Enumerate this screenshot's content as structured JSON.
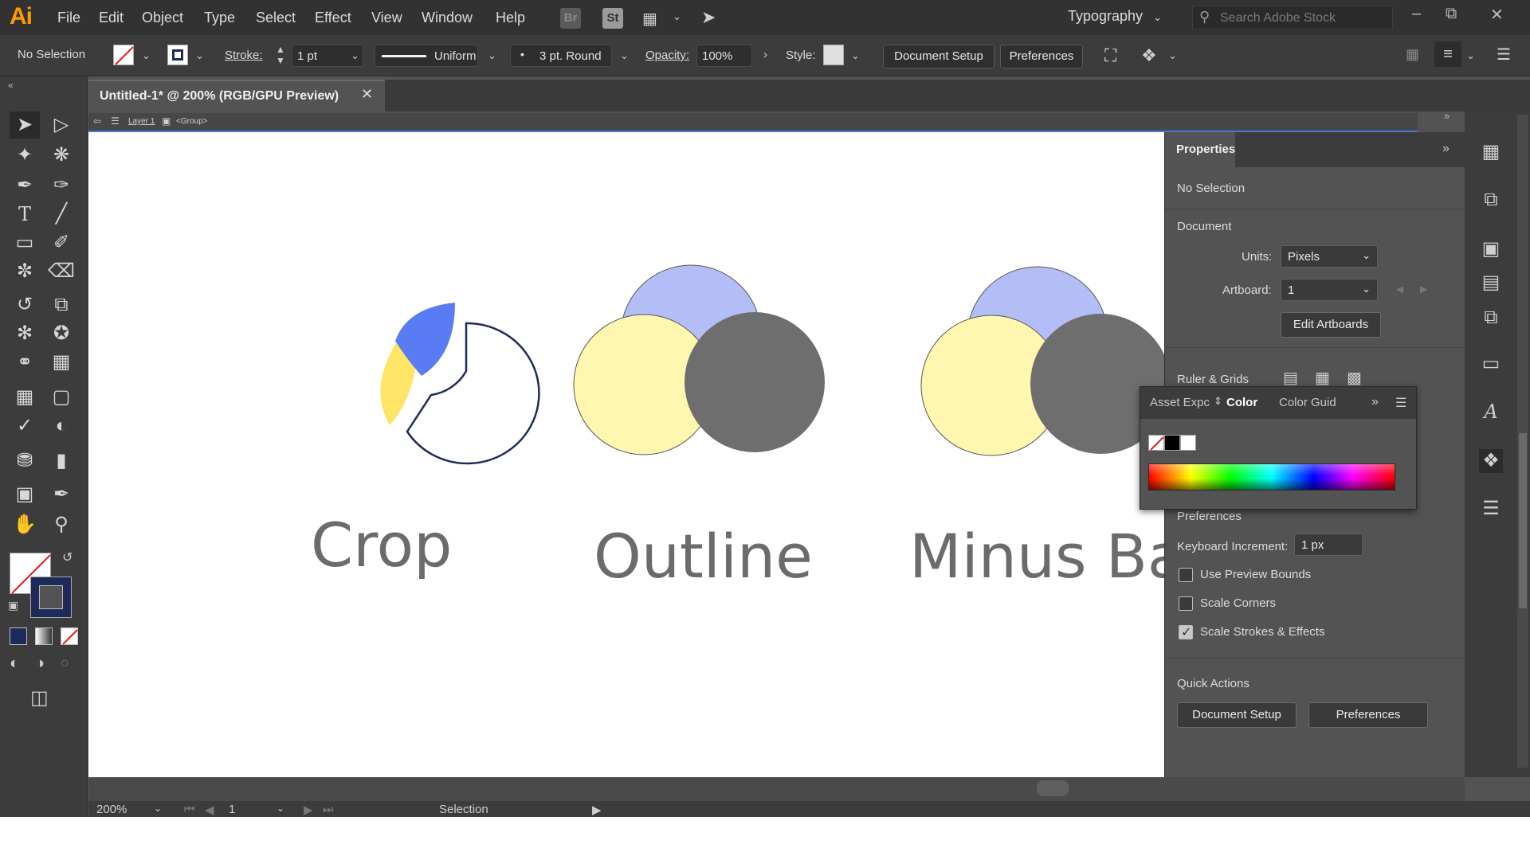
{
  "app": {
    "logo": "Ai",
    "menu": [
      "File",
      "Edit",
      "Object",
      "Type",
      "Select",
      "Effect",
      "View",
      "Window",
      "Help"
    ],
    "badges": [
      "Br",
      "St"
    ],
    "workspace": "Typography",
    "search_placeholder": "Search Adobe Stock"
  },
  "controlbar": {
    "selection_label": "No Selection",
    "stroke_label": "Stroke:",
    "stroke_weight": "1 pt",
    "profile": "Uniform",
    "brush": "3 pt. Round",
    "opacity_label": "Opacity:",
    "opacity_value": "100%",
    "style_label": "Style:",
    "document_setup": "Document Setup",
    "preferences": "Preferences"
  },
  "document": {
    "tab_title": "Untitled-1* @ 200% (RGB/GPU Preview)",
    "breadcrumb_layer": "Layer 1",
    "breadcrumb_group": "<Group>"
  },
  "canvas": {
    "labels": [
      "Crop",
      "Outline",
      "Minus Bac"
    ],
    "colors": {
      "yellow": "#FFE566",
      "blue": "#5A7CF3",
      "light_yellow": "#FFF6B0",
      "light_blue": "#B3BEF7",
      "gray": "#6E6E6E",
      "navy": "#1E2A5A"
    }
  },
  "properties": {
    "title": "Properties",
    "no_selection": "No Selection",
    "document_heading": "Document",
    "units_label": "Units:",
    "units_value": "Pixels",
    "artboard_label": "Artboard:",
    "artboard_value": "1",
    "edit_artboards": "Edit Artboards",
    "ruler_grids": "Ruler & Grids",
    "preferences_heading": "Preferences",
    "keyboard_increment_label": "Keyboard Increment:",
    "keyboard_increment_value": "1 px",
    "use_preview_bounds": "Use Preview Bounds",
    "scale_corners": "Scale Corners",
    "scale_strokes_effects": "Scale Strokes & Effects",
    "quick_actions": "Quick Actions",
    "document_setup": "Document Setup",
    "preferences_btn": "Preferences"
  },
  "color_panel": {
    "tabs": [
      "Asset Expc",
      "Color",
      "Color Guid"
    ]
  },
  "status": {
    "zoom": "200%",
    "artboard": "1",
    "tool": "Selection"
  }
}
